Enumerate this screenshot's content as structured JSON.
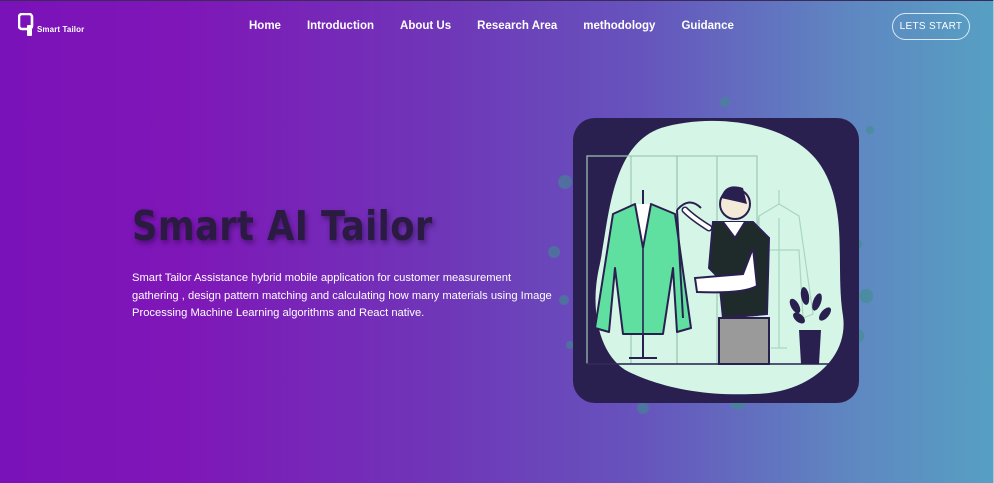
{
  "brand": {
    "name": "Smart Tailor"
  },
  "nav": {
    "items": [
      {
        "label": "Home"
      },
      {
        "label": "Introduction"
      },
      {
        "label": "About Us"
      },
      {
        "label": "Research Area"
      },
      {
        "label": "methodology"
      },
      {
        "label": "Guidance"
      }
    ]
  },
  "cta": {
    "label": "LETS START"
  },
  "hero": {
    "title": "Smart AI Tailor",
    "description": "Smart Tailor Assistance hybrid mobile application for customer measurement gathering , design pattern matching and calculating how many materials using Image Processing Machine Learning algorithms and React native."
  },
  "colors": {
    "gradient_left": "#7a12b9",
    "gradient_right": "#56a0c3",
    "title": "#2b1b43",
    "illustration_bg": "#2a2050",
    "mint": "#d5f5e6",
    "jacket_green": "#5fe0a0"
  },
  "icons": {
    "logo": "q-logo-icon",
    "illustration": "tailor-measuring-mannequin"
  }
}
